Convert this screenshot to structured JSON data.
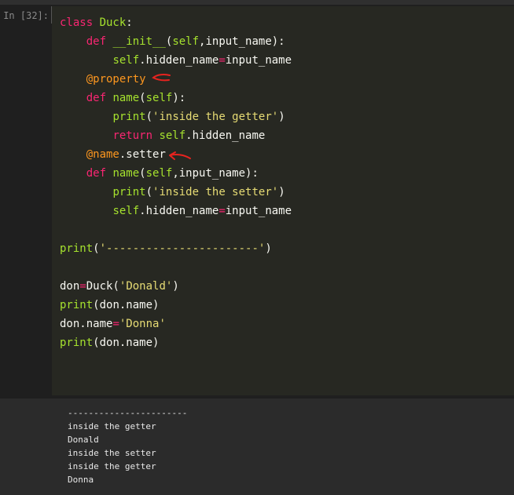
{
  "cell": {
    "prompt": "In [32]:",
    "code_lines": [
      [
        {
          "t": "class ",
          "c": "kw"
        },
        {
          "t": "Duck",
          "c": "cls"
        },
        {
          "t": ":",
          "c": ""
        }
      ],
      [
        {
          "t": "    ",
          "c": ""
        },
        {
          "t": "def ",
          "c": "kw"
        },
        {
          "t": "__init__",
          "c": "fn"
        },
        {
          "t": "(",
          "c": ""
        },
        {
          "t": "self",
          "c": "self"
        },
        {
          "t": ",input_name):",
          "c": ""
        }
      ],
      [
        {
          "t": "        ",
          "c": ""
        },
        {
          "t": "self",
          "c": "self"
        },
        {
          "t": ".hidden_name",
          "c": ""
        },
        {
          "t": "=",
          "c": "op"
        },
        {
          "t": "input_name",
          "c": ""
        }
      ],
      [
        {
          "t": "    ",
          "c": ""
        },
        {
          "t": "@property",
          "c": "deco"
        }
      ],
      [
        {
          "t": "    ",
          "c": ""
        },
        {
          "t": "def ",
          "c": "kw"
        },
        {
          "t": "name",
          "c": "fn"
        },
        {
          "t": "(",
          "c": ""
        },
        {
          "t": "self",
          "c": "self"
        },
        {
          "t": "):",
          "c": ""
        }
      ],
      [
        {
          "t": "        ",
          "c": ""
        },
        {
          "t": "print",
          "c": "bi"
        },
        {
          "t": "(",
          "c": ""
        },
        {
          "t": "'inside the getter'",
          "c": "str"
        },
        {
          "t": ")",
          "c": ""
        }
      ],
      [
        {
          "t": "        ",
          "c": ""
        },
        {
          "t": "return ",
          "c": "kw"
        },
        {
          "t": "self",
          "c": "self"
        },
        {
          "t": ".hidden_name",
          "c": ""
        }
      ],
      [
        {
          "t": "    ",
          "c": ""
        },
        {
          "t": "@name",
          "c": "deco"
        },
        {
          "t": ".setter",
          "c": ""
        }
      ],
      [
        {
          "t": "    ",
          "c": ""
        },
        {
          "t": "def ",
          "c": "kw"
        },
        {
          "t": "name",
          "c": "fn"
        },
        {
          "t": "(",
          "c": ""
        },
        {
          "t": "self",
          "c": "self"
        },
        {
          "t": ",input_name):",
          "c": ""
        }
      ],
      [
        {
          "t": "        ",
          "c": ""
        },
        {
          "t": "print",
          "c": "bi"
        },
        {
          "t": "(",
          "c": ""
        },
        {
          "t": "'inside the setter'",
          "c": "str"
        },
        {
          "t": ")",
          "c": ""
        }
      ],
      [
        {
          "t": "        ",
          "c": ""
        },
        {
          "t": "self",
          "c": "self"
        },
        {
          "t": ".hidden_name",
          "c": ""
        },
        {
          "t": "=",
          "c": "op"
        },
        {
          "t": "input_name",
          "c": ""
        }
      ],
      [],
      [
        {
          "t": "print",
          "c": "bi"
        },
        {
          "t": "(",
          "c": ""
        },
        {
          "t": "'-----------------------'",
          "c": "str"
        },
        {
          "t": ")",
          "c": ""
        }
      ],
      [],
      [
        {
          "t": "don",
          "c": ""
        },
        {
          "t": "=",
          "c": "op"
        },
        {
          "t": "Duck(",
          "c": ""
        },
        {
          "t": "'Donald'",
          "c": "str"
        },
        {
          "t": ")",
          "c": ""
        }
      ],
      [
        {
          "t": "print",
          "c": "bi"
        },
        {
          "t": "(don.name)",
          "c": ""
        }
      ],
      [
        {
          "t": "don.name",
          "c": ""
        },
        {
          "t": "=",
          "c": "op"
        },
        {
          "t": "'Donna'",
          "c": "str"
        }
      ],
      [
        {
          "t": "print",
          "c": "bi"
        },
        {
          "t": "(don.name)",
          "c": ""
        }
      ]
    ]
  },
  "output": {
    "lines": [
      "-----------------------",
      "inside the getter",
      "Donald",
      "inside the setter",
      "inside the getter",
      "Donna"
    ]
  },
  "colors": {
    "keyword": "#f92672",
    "string": "#e6db74",
    "builtin": "#a6e22e",
    "decorator": "#fd971f",
    "annotation_arrow": "#e8231f"
  }
}
